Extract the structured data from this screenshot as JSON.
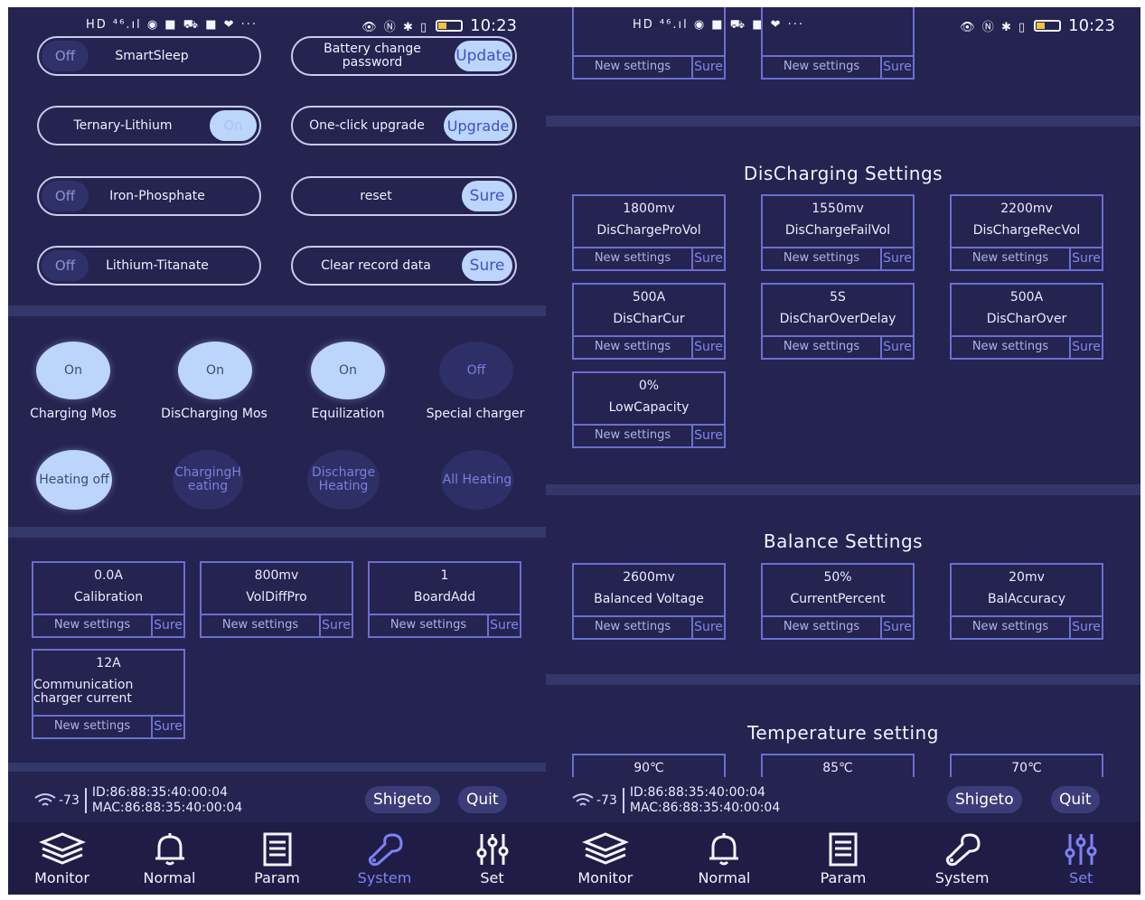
{
  "status": {
    "icons": "HD ⁴⁶.ıl ◉ ■ ⛟ ■ ❤ ···",
    "right_icons": "👁 Ⓝ ✱ ▯",
    "time": "10:23"
  },
  "left": {
    "toggles": [
      {
        "label": "SmartSleep",
        "state": "Off"
      },
      {
        "label": "Battery change password",
        "button": "Update"
      },
      {
        "label": "Ternary-Lithium",
        "state": "On"
      },
      {
        "label": "One-click upgrade",
        "button": "Upgrade"
      },
      {
        "label": "Iron-Phosphate",
        "state": "Off"
      },
      {
        "label": "reset",
        "button": "Sure"
      },
      {
        "label": "Lithium-Titanate",
        "state": "Off"
      },
      {
        "label": "Clear record data",
        "button": "Sure"
      }
    ],
    "switches": [
      {
        "state": "On",
        "label": "Charging Mos"
      },
      {
        "state": "On",
        "label": "DisCharging Mos"
      },
      {
        "state": "On",
        "label": "Equilization"
      },
      {
        "state": "Off",
        "label": "Special charger"
      }
    ],
    "heating": [
      "Heating off",
      "ChargingH eating",
      "Discharge Heating",
      "All Heating"
    ],
    "cards": [
      {
        "value": "0.0A",
        "name": "Calibration"
      },
      {
        "value": "800mv",
        "name": "VolDiffPro"
      },
      {
        "value": "1",
        "name": "BoardAdd"
      },
      {
        "value": "12A",
        "name": "Communication charger current"
      }
    ]
  },
  "right": {
    "top_cards": [
      {
        "value": ""
      },
      {
        "value": ""
      }
    ],
    "discharging_title": "DisCharging Settings",
    "discharging": [
      {
        "value": "1800mv",
        "name": "DisChargeProVol"
      },
      {
        "value": "1550mv",
        "name": "DisChargeFailVol"
      },
      {
        "value": "2200mv",
        "name": "DisChargeRecVol"
      },
      {
        "value": "500A",
        "name": "DisCharCur"
      },
      {
        "value": "5S",
        "name": "DisCharOverDelay"
      },
      {
        "value": "500A",
        "name": "DisCharOver"
      },
      {
        "value": "0%",
        "name": "LowCapacity"
      }
    ],
    "balance_title": "Balance Settings",
    "balance": [
      {
        "value": "2600mv",
        "name": "Balanced Voltage"
      },
      {
        "value": "50%",
        "name": "CurrentPercent"
      },
      {
        "value": "20mv",
        "name": "BalAccuracy"
      }
    ],
    "temperature_title": "Temperature setting",
    "temperature": [
      {
        "value": "90℃"
      },
      {
        "value": "85℃"
      },
      {
        "value": "70℃"
      }
    ]
  },
  "common": {
    "new_settings": "New settings",
    "sure": "Sure",
    "rssi": "-73",
    "id": "ID:86:88:35:40:00:04",
    "mac": "MAC:86:88:35:40:00:04",
    "user": "Shigeto",
    "quit": "Quit",
    "tabs": [
      "Monitor",
      "Normal",
      "Param",
      "System",
      "Set"
    ]
  },
  "colors": {
    "background": "#252350",
    "accent": "#7c82f4",
    "knob_on": "#bcd5fb",
    "card_border": "#6a6fd0"
  }
}
